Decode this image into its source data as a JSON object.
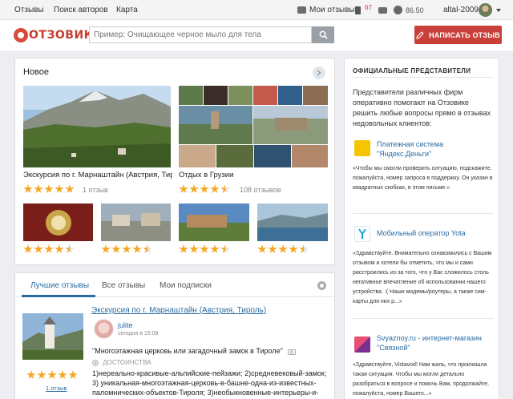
{
  "topnav": {
    "links": [
      "Отзывы",
      "Поиск авторов",
      "Карта"
    ],
    "my_reviews": "Мои отзывы",
    "notifications_count": "67",
    "points": "86.50",
    "username": "altal-2009"
  },
  "header": {
    "logo_text": "ОТЗОВИК",
    "search_placeholder": "Пример: Очищающее черное мыло для тела",
    "write_button": "НАПИСАТЬ ОТЗЫВ"
  },
  "new_section": {
    "heading": "Новое",
    "cards": [
      {
        "title": "Экскурсия по г. Марнаштайн (Австрия, Тир...",
        "rating": 5,
        "count": "1 отзыв"
      },
      {
        "title": "Отдых в Грузии",
        "rating": 4.5,
        "count": "108 отзывов"
      }
    ],
    "small_ratings": [
      4.5,
      4.5,
      4.5,
      4.5
    ]
  },
  "reviews": {
    "tabs": [
      "Лучшие отзывы",
      "Все отзывы",
      "Мои подписки"
    ],
    "active_tab": 0,
    "item": {
      "title": "Экскурсия по г. Марнаштайн (Австрия, Тироль)",
      "user": "julite",
      "date": "сегодня в 15:09",
      "quote": "\"Многоэтажная церковь или загадочный замок в Тироле\"",
      "pros_label": "ДОСТОИНСТВА:",
      "pros": "1)нереально-красивые-альпийские-пейзажи; 2)средневековый-замок; 3) уникальная-многоэтажная-церковь-в-башне-одна-из-известных-паломнических-объектов-Тироля; 3)необыкновенные-интерьеры-и-",
      "rating": 5,
      "count": "1 отзыв"
    }
  },
  "reps": {
    "title": "ОФИЦИАЛЬНЫЕ ПРЕДСТАВИТЕЛИ",
    "intro": "Представители различных фирм оперативно помогают на Отзовике решить любые вопросы прямо в отзывах недовольных клиентов:",
    "items": [
      {
        "name_line1": "Платежная система",
        "name_line2": "\"Яндекс.Деньги\"",
        "text": "«Чтобы мы смогли проверить ситуацию, подскажите, пожалуйста, номер запроса в поддержку. Он указан в квадратных скобках, в этом письме.»",
        "color": "#f7c400"
      },
      {
        "name_line1": "Мобильный оператор Yota",
        "name_line2": "",
        "text": "«Здравствуйте. Внимательно ознакомились с Вашим отзывом и хотели бы отметить, что мы и сами расстроились из-за того, что у Вас сложилось столь негативное впечатление об использовании нашего устройства. :( Наши модемы/роутеры, а также сим-карты для них р...»",
        "color": "#1ba6d9"
      },
      {
        "name_line1": "Svyaznoy.ru - интернет-магазин",
        "name_line2": "\"Связной\"",
        "text": "«Здравствуйте, Vistavod! Нам жаль, что произошла такая ситуация. Чтобы мы могли детально разобраться в вопросе и помочь Вам, продолжайте, пожалуйста, номер Вашего...»",
        "color": "#e94e77"
      }
    ]
  }
}
